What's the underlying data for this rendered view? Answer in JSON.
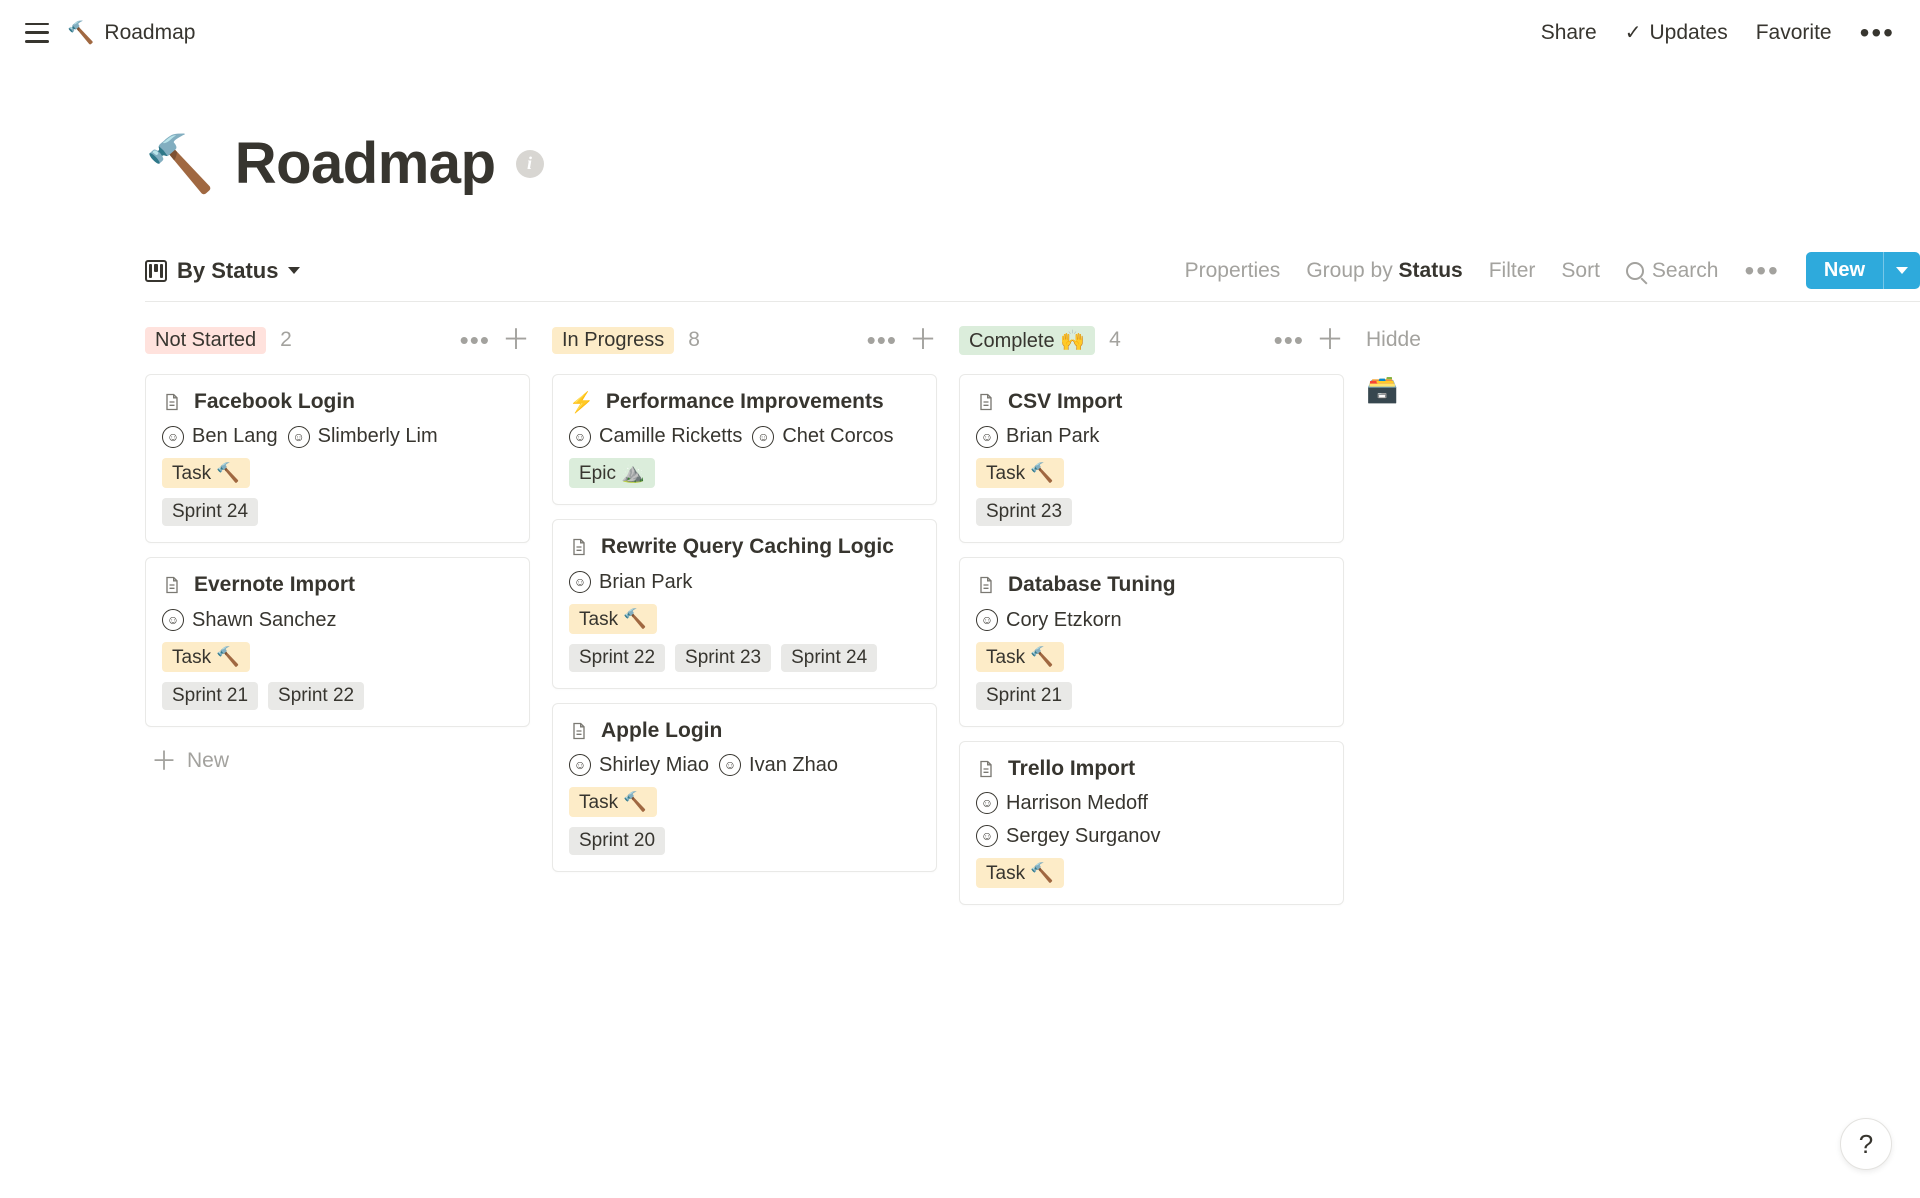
{
  "topbar": {
    "breadcrumb_icon": "🔨",
    "breadcrumb_text": "Roadmap",
    "share": "Share",
    "updates": "Updates",
    "favorite": "Favorite"
  },
  "header": {
    "icon": "🔨",
    "title": "Roadmap"
  },
  "toolbar": {
    "view_label": "By Status",
    "properties": "Properties",
    "groupby_prefix": "Group by ",
    "groupby_value": "Status",
    "filter": "Filter",
    "sort": "Sort",
    "search": "Search",
    "new": "New"
  },
  "columns": [
    {
      "key": "not_started",
      "title": "Not Started",
      "emoji": "",
      "count": "2",
      "tag_class": "tag-notstarted",
      "cards": [
        {
          "icon_type": "page",
          "title": "Facebook Login",
          "assignees": [
            "Ben Lang",
            "Slimberly Lim"
          ],
          "type_chip": {
            "label": "Task 🔨",
            "class": "chip-task"
          },
          "sprints": [
            "Sprint 24"
          ]
        },
        {
          "icon_type": "page",
          "title": "Evernote Import",
          "assignees": [
            "Shawn Sanchez"
          ],
          "type_chip": {
            "label": "Task 🔨",
            "class": "chip-task"
          },
          "sprints": [
            "Sprint 21",
            "Sprint 22"
          ]
        }
      ],
      "add_label": "New"
    },
    {
      "key": "in_progress",
      "title": "In Progress",
      "emoji": "",
      "count": "8",
      "tag_class": "tag-inprogress",
      "cards": [
        {
          "icon_type": "bolt",
          "title": "Performance Improvements",
          "assignees": [
            "Camille Ricketts",
            "Chet Corcos"
          ],
          "type_chip": {
            "label": "Epic ⛰️",
            "class": "chip-epic"
          },
          "sprints": []
        },
        {
          "icon_type": "page",
          "title": "Rewrite Query Caching Logic",
          "assignees": [
            "Brian Park"
          ],
          "type_chip": {
            "label": "Task 🔨",
            "class": "chip-task"
          },
          "sprints": [
            "Sprint 22",
            "Sprint 23",
            "Sprint 24"
          ]
        },
        {
          "icon_type": "page",
          "title": "Apple Login",
          "assignees": [
            "Shirley Miao",
            "Ivan Zhao"
          ],
          "type_chip": {
            "label": "Task 🔨",
            "class": "chip-task"
          },
          "sprints": [
            "Sprint 20"
          ]
        }
      ]
    },
    {
      "key": "complete",
      "title": "Complete 🙌",
      "emoji": "",
      "count": "4",
      "tag_class": "tag-complete",
      "cards": [
        {
          "icon_type": "page",
          "title": "CSV Import",
          "assignees": [
            "Brian Park"
          ],
          "type_chip": {
            "label": "Task 🔨",
            "class": "chip-task"
          },
          "sprints": [
            "Sprint 23"
          ]
        },
        {
          "icon_type": "page",
          "title": "Database Tuning",
          "assignees": [
            "Cory Etzkorn"
          ],
          "type_chip": {
            "label": "Task 🔨",
            "class": "chip-task"
          },
          "sprints": [
            "Sprint 21"
          ]
        },
        {
          "icon_type": "page",
          "title": "Trello Import",
          "assignees": [
            "Harrison Medoff",
            "Sergey Surganov"
          ],
          "type_chip": {
            "label": "Task 🔨",
            "class": "chip-task"
          },
          "sprints": []
        }
      ]
    }
  ],
  "hidden_label": "Hidde",
  "help": "?"
}
